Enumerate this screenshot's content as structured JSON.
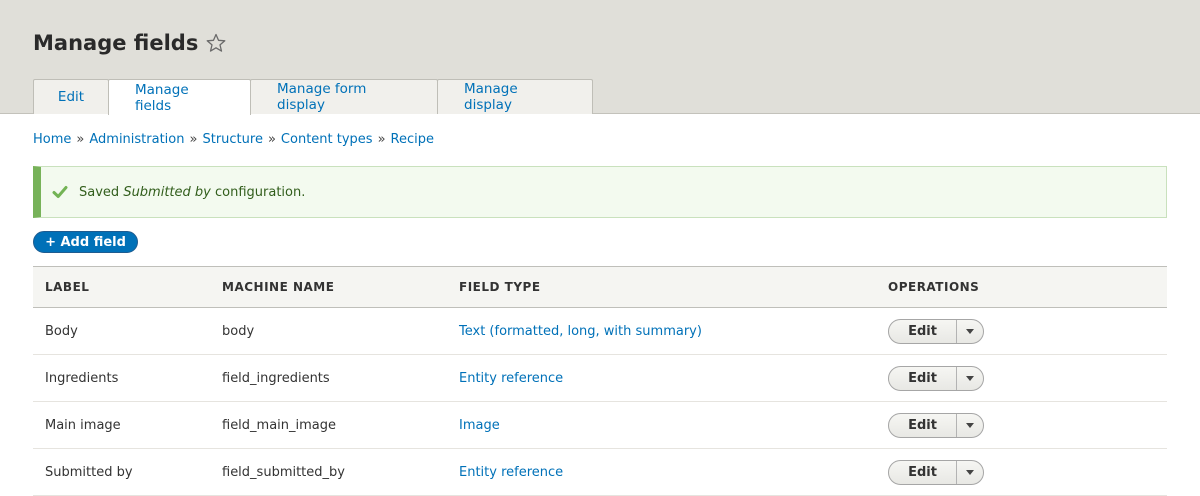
{
  "page": {
    "title": "Manage fields"
  },
  "tabs": [
    {
      "label": "Edit"
    },
    {
      "label": "Manage fields"
    },
    {
      "label": "Manage form display"
    },
    {
      "label": "Manage display"
    }
  ],
  "breadcrumb": {
    "separator": "»",
    "items": [
      "Home",
      "Administration",
      "Structure",
      "Content types",
      "Recipe"
    ]
  },
  "message": {
    "prefix": "Saved",
    "emphasis": "Submitted by",
    "suffix": "configuration."
  },
  "add_button": {
    "label": "+ Add field"
  },
  "table": {
    "headers": [
      "LABEL",
      "MACHINE NAME",
      "FIELD TYPE",
      "OPERATIONS"
    ],
    "rows": [
      {
        "label": "Body",
        "machine_name": "body",
        "field_type": "Text (formatted, long, with summary)",
        "operation": "Edit"
      },
      {
        "label": "Ingredients",
        "machine_name": "field_ingredients",
        "field_type": "Entity reference",
        "operation": "Edit"
      },
      {
        "label": "Main image",
        "machine_name": "field_main_image",
        "field_type": "Image",
        "operation": "Edit"
      },
      {
        "label": "Submitted by",
        "machine_name": "field_submitted_by",
        "field_type": "Entity reference",
        "operation": "Edit"
      }
    ]
  },
  "colors": {
    "link": "#0071b8",
    "header_bg": "#e0dfd9",
    "success": "#77b259"
  },
  "icons": {
    "favorite": "star-icon",
    "status": "checkmark-icon",
    "dropdown": "caret-down-icon"
  }
}
